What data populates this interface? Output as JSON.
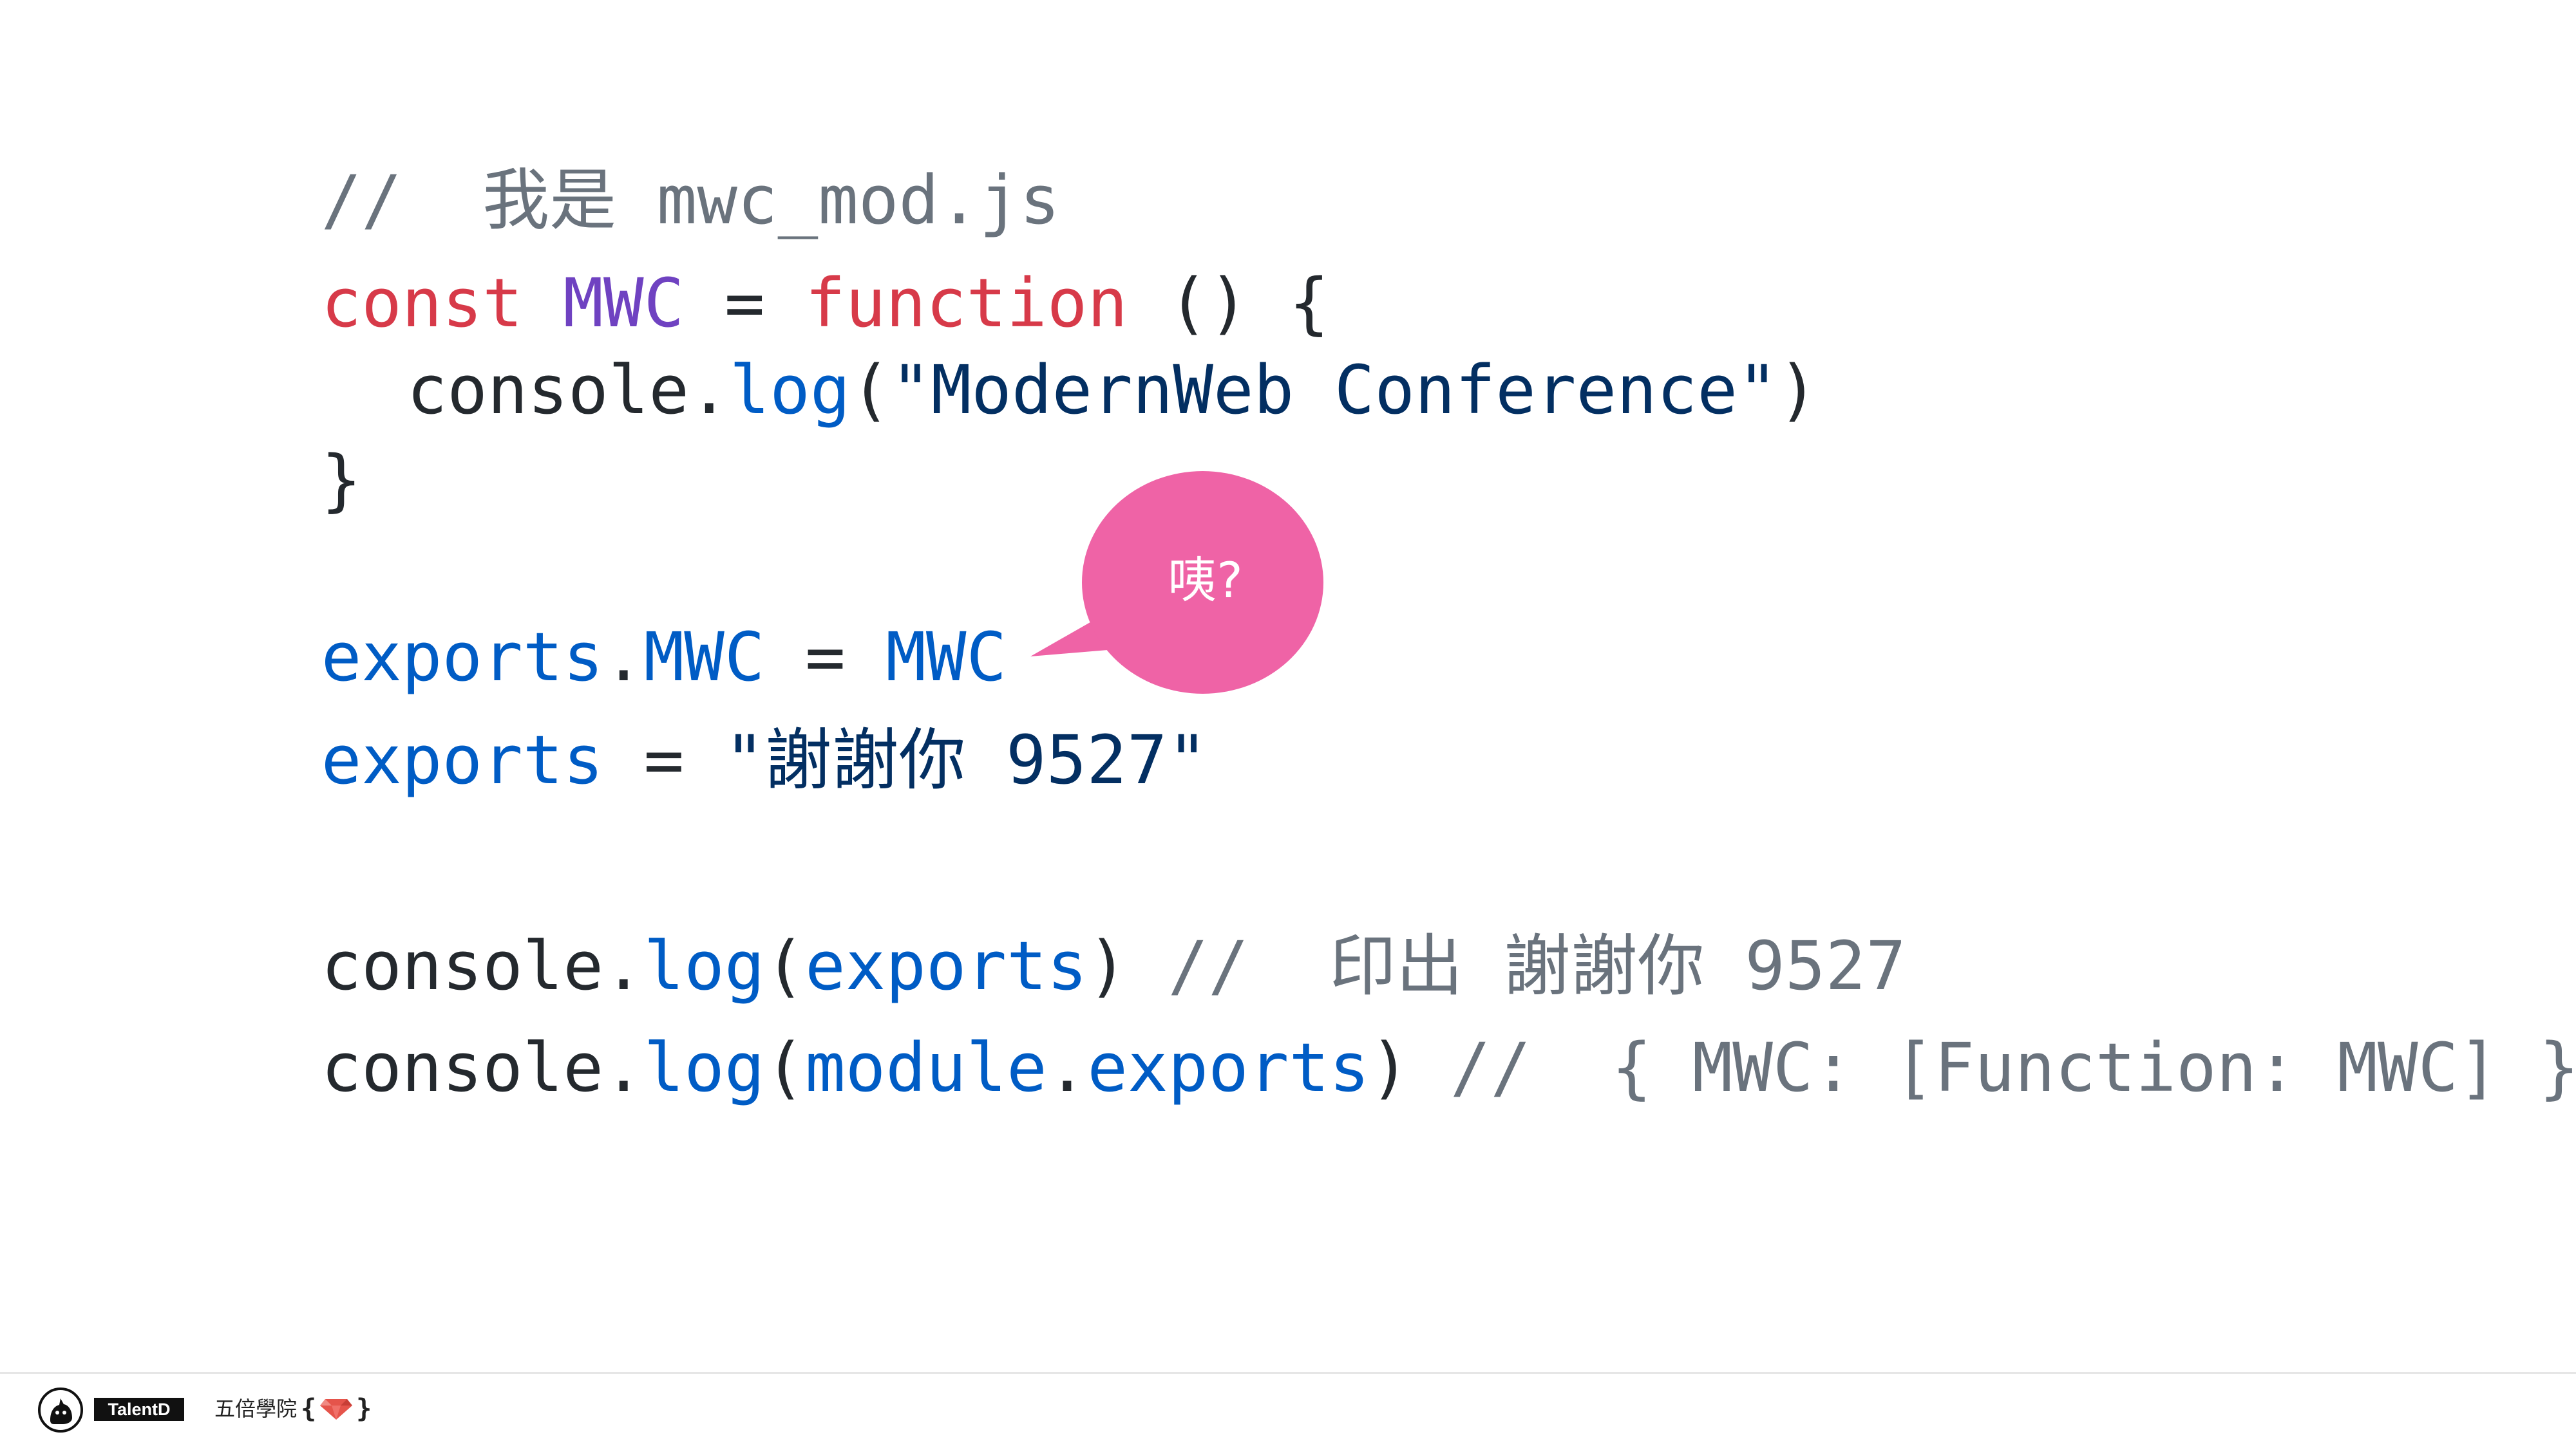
{
  "code": {
    "line1": {
      "comment": "//  我是 mwc_mod.js"
    },
    "line2": {
      "keyword_const": "const",
      "name": "MWC",
      "equals": " = ",
      "keyword_function": "function",
      "rest": " () {"
    },
    "line3": {
      "obj": "console.",
      "method": "log",
      "open": "(",
      "string": "\"ModernWeb Conference\"",
      "close": ")"
    },
    "line4": {
      "brace": "}"
    },
    "line5": {
      "exports": "exports",
      "dot": ".",
      "prop": "MWC",
      "equals": " = ",
      "value": "MWC"
    },
    "line6": {
      "exports": "exports",
      "equals": " = ",
      "string": "\"謝謝你 9527\""
    },
    "line7": {
      "obj": "console.",
      "method": "log",
      "open": "(",
      "arg": "exports",
      "close": ") ",
      "comment": "//  印出 謝謝你 9527"
    },
    "line8": {
      "obj": "console.",
      "method": "log",
      "open": "(",
      "arg_obj": "module",
      "dot": ".",
      "arg_prop": "exports",
      "close": ") ",
      "comment": "//  { MWC: [Function: MWC] }"
    }
  },
  "bubble": {
    "text": "咦?"
  },
  "footer": {
    "talentd_label": "TalentD",
    "academy_name": "五倍學院",
    "brace_open": "{",
    "brace_close": "}"
  },
  "colors": {
    "comment": "#6a737d",
    "keyword": "#d73a49",
    "class_name": "#6f42c1",
    "function_name": "#005cc5",
    "string": "#032f62",
    "plain": "#24292e",
    "bubble": "#ef63a6"
  }
}
